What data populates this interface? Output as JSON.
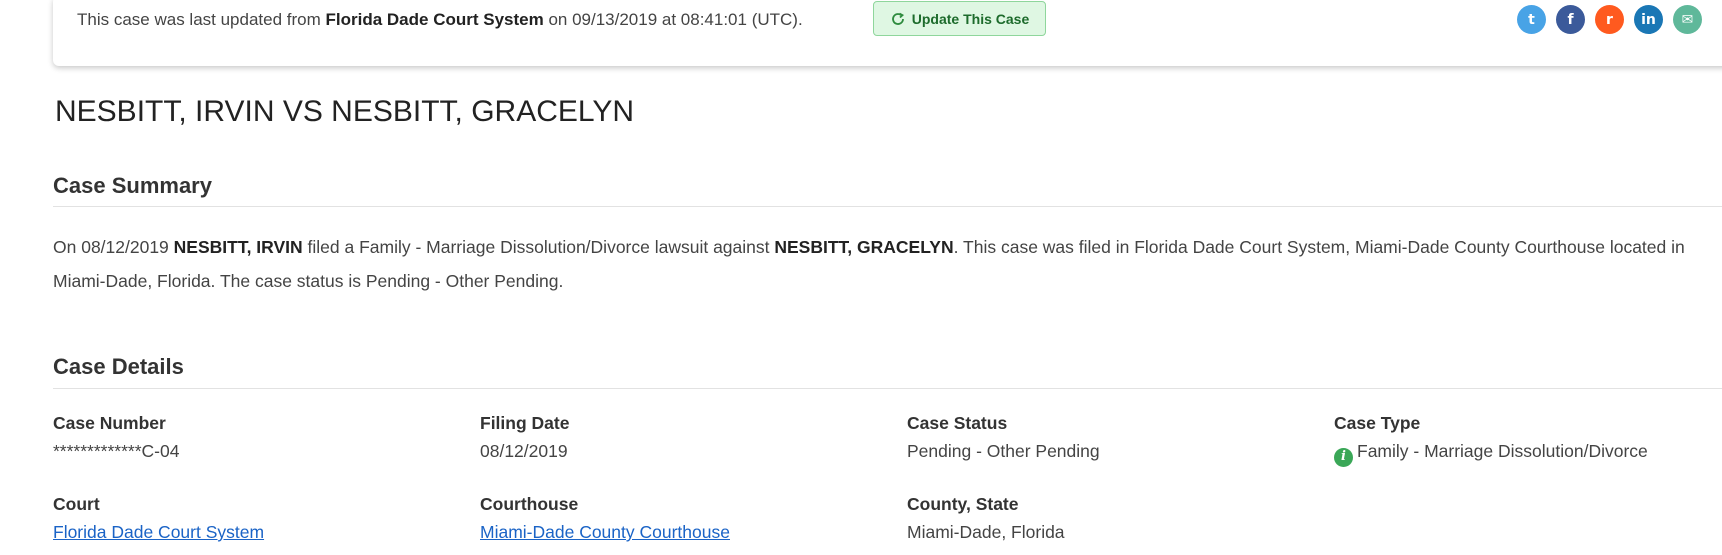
{
  "update_bar": {
    "prefix": "This case was last updated from ",
    "source": "Florida Dade Court System",
    "suffix": " on 09/13/2019 at 08:41:01 (UTC).",
    "button_label": "Update This Case"
  },
  "share_icons": [
    {
      "name": "twitter-icon",
      "glyph": "t"
    },
    {
      "name": "facebook-icon",
      "glyph": "f"
    },
    {
      "name": "reddit-icon",
      "glyph": "r"
    },
    {
      "name": "linkedin-icon",
      "glyph": "in"
    },
    {
      "name": "email-icon",
      "glyph": "✉"
    }
  ],
  "case_title": "NESBITT, IRVIN VS NESBITT, GRACELYN",
  "summary": {
    "heading": "Case Summary",
    "p1": "On 08/12/2019 ",
    "plaintiff": "NESBITT, IRVIN",
    "p2": " filed a Family - Marriage Dissolution/Divorce lawsuit against ",
    "defendant": "NESBITT, GRACELYN",
    "p3": ". This case was filed in Florida Dade Court System, Miami-Dade County Courthouse located in Miami-Dade, Florida. The case status is Pending - Other Pending."
  },
  "details": {
    "heading": "Case Details",
    "case_number_label": "Case Number",
    "case_number": "*************C-04",
    "filing_date_label": "Filing Date",
    "filing_date": "08/12/2019",
    "case_status_label": "Case Status",
    "case_status": "Pending - Other Pending",
    "case_type_label": "Case Type",
    "case_type": "Family - Marriage Dissolution/Divorce",
    "court_label": "Court",
    "court": "Florida Dade Court System",
    "courthouse_label": "Courthouse",
    "courthouse": "Miami-Dade County Courthouse",
    "county_state_label": "County, State",
    "county_state": "Miami-Dade, Florida"
  }
}
